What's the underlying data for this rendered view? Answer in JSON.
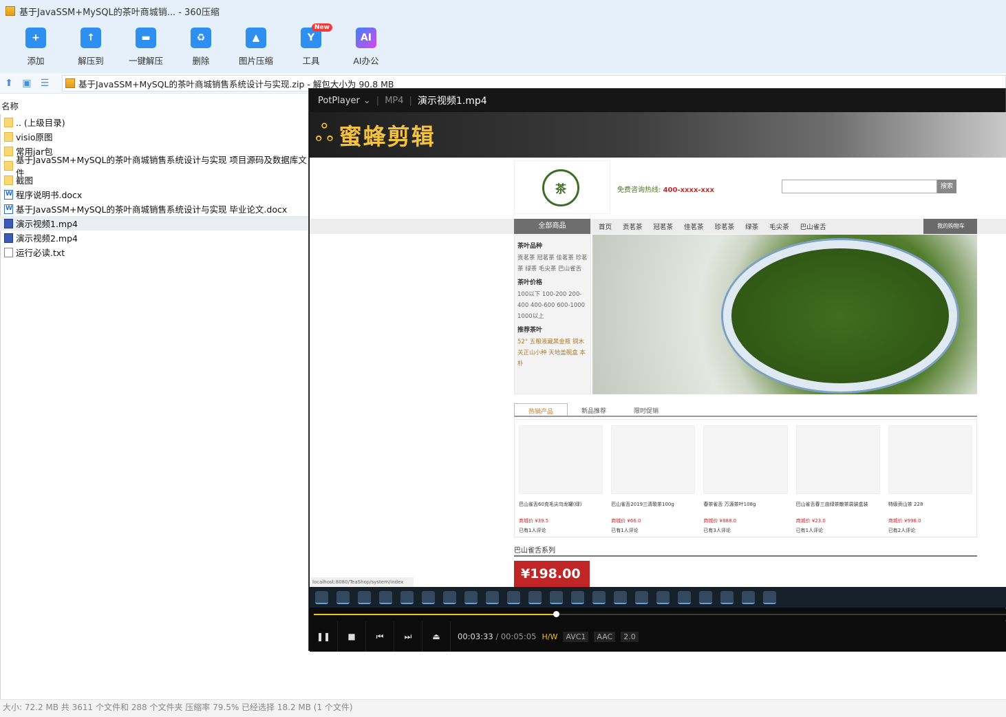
{
  "zip": {
    "title": "基于JavaSSM+MySQL的茶叶商城销... - 360压缩",
    "toolbar": [
      {
        "label": "添加",
        "icon": "add-icon"
      },
      {
        "label": "解压到",
        "icon": "extract-to-icon"
      },
      {
        "label": "一键解压",
        "icon": "one-click-extract-icon"
      },
      {
        "label": "删除",
        "icon": "delete-icon"
      },
      {
        "label": "图片压缩",
        "icon": "image-compress-icon"
      },
      {
        "label": "工具",
        "icon": "tools-icon",
        "badge": "New"
      },
      {
        "label": "AI办公",
        "icon": "ai-office-icon"
      }
    ],
    "path": "基于JavaSSM+MySQL的茶叶商城销售系统设计与实现.zip - 解包大小为 90.8 MB",
    "column_name": "名称",
    "files": [
      {
        "name": ".. (上级目录)",
        "type": "folder"
      },
      {
        "name": "visio原图",
        "type": "folder"
      },
      {
        "name": "常用jar包",
        "type": "folder"
      },
      {
        "name": "基于JavaSSM+MySQL的茶叶商城销售系统设计与实现 项目源码及数据库文件",
        "type": "folder"
      },
      {
        "name": "截图",
        "type": "folder"
      },
      {
        "name": "程序说明书.docx",
        "type": "docx"
      },
      {
        "name": "基于JavaSSM+MySQL的茶叶商城销售系统设计与实现 毕业论文.docx",
        "type": "docx"
      },
      {
        "name": "演示视频1.mp4",
        "type": "mp4",
        "selected": true
      },
      {
        "name": "演示视频2.mp4",
        "type": "mp4"
      },
      {
        "name": "运行必读.txt",
        "type": "txt"
      }
    ],
    "status": "大小: 72.2 MB 共 3611 个文件和 288 个文件夹 压缩率 79.5% 已经选择 18.2 MB (1 个文件)"
  },
  "player": {
    "app": "PotPlayer",
    "format": "MP4",
    "filename": "演示视频1.mp4",
    "watermark": "蜜蜂剪辑",
    "current_time": "00:03:33",
    "total_time": "/ 00:05:05",
    "progress": 0.35,
    "tags": [
      "H/W",
      "AVC1",
      "AAC",
      "2.0"
    ]
  },
  "site": {
    "hotline_label": "免费咨询热线:",
    "hotline": "400-xxxx-xxx",
    "search_btn": "搜索",
    "all_goods": "全部商品",
    "nav": [
      "首页",
      "贡茗茶",
      "冠茗茶",
      "佳茗茶",
      "珍茗茶",
      "绿茶",
      "毛尖茶",
      "巴山雀舌"
    ],
    "cart": "我的购物车",
    "side": {
      "h1": "茶叶品种",
      "p1": "贡茗茶 冠茗茶 佳茗茶 珍茗茶 绿茶 毛尖茶 巴山雀舌",
      "h2": "茶叶价格",
      "p2": "100以下 100-200 200-400 400-600 600-1000 1000以上",
      "h3": "推荐茶叶",
      "p3": "52° 五粮液藏黑金瓶 铜木关正山小种 天地盖碗盒 本朴"
    },
    "tabs": [
      "热销产品",
      "新品推荐",
      "限时促销"
    ],
    "products": [
      {
        "name": "巴山雀舌60克毛尖乌龙罐(绿)",
        "price": "商城价 ¥39.5",
        "reviews": "已有1人评论"
      },
      {
        "name": "巴山雀舌2019三清歌茶100g",
        "price": "商城价 ¥66.0",
        "reviews": "已有1人评论"
      },
      {
        "name": "春茶雀舌 万源茶叶108g",
        "price": "商城价 ¥888.0",
        "reviews": "已有3人评论"
      },
      {
        "name": "巴山雀舌春三亩绿茶散茶袋装盒装",
        "price": "商城价 ¥23.0",
        "reviews": "已有1人评论"
      },
      {
        "name": "特级贡山茶 228",
        "price": "商城价 ¥998.0",
        "reviews": "已有2人评论"
      }
    ],
    "series": "巴山雀舌系列",
    "promo": "¥198.00",
    "url": "localhost:8080/TeaShop/system/index"
  }
}
